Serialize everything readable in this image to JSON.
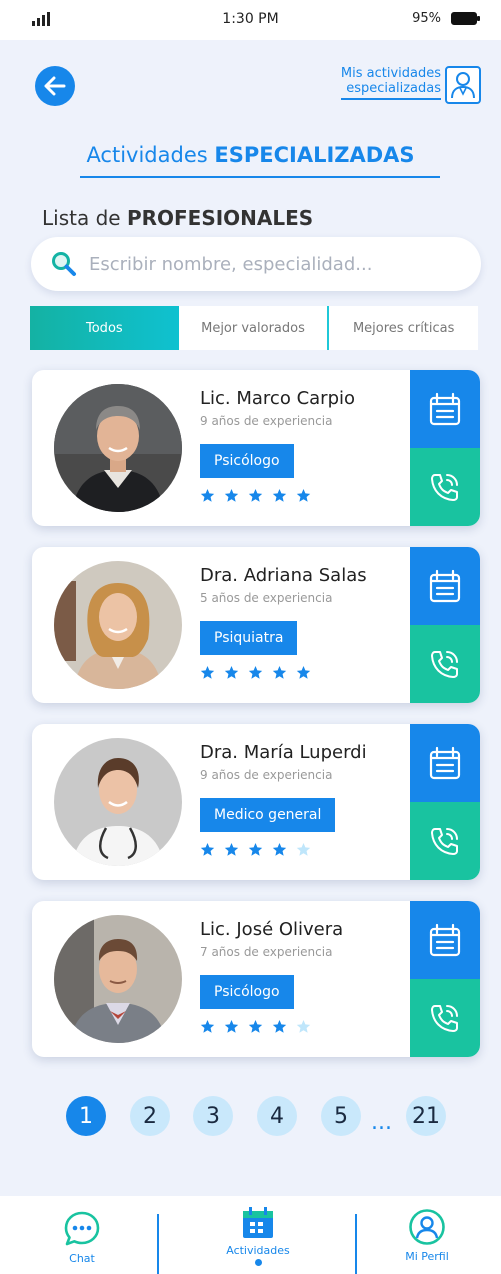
{
  "status_bar": {
    "time": "1:30 PM",
    "battery": "95%"
  },
  "header": {
    "my_activities_line1": "Mis actividades",
    "my_activities_line2": "especializadas",
    "title_normal": "Actividades ",
    "title_bold": "ESPECIALIZADAS"
  },
  "list": {
    "title_normal": "Lista de ",
    "title_bold": "PROFESIONALES"
  },
  "search": {
    "placeholder": "Escribir nombre, especialidad..."
  },
  "tabs": [
    {
      "label": "Todos",
      "active": true
    },
    {
      "label": "Mejor valorados",
      "active": false
    },
    {
      "label": "Mejores críticas",
      "active": false
    }
  ],
  "professionals": [
    {
      "name": "Lic. Marco Carpio",
      "experience": "9 años de experiencia",
      "specialty": "Psicólogo",
      "rating": 5
    },
    {
      "name": "Dra. Adriana Salas",
      "experience": "5 años de experiencia",
      "specialty": "Psiquiatra",
      "rating": 5
    },
    {
      "name": "Dra. María Luperdi",
      "experience": "9 años de experiencia",
      "specialty": "Medico general",
      "rating": 4
    },
    {
      "name": "Lic. José Olivera",
      "experience": "7 años de experiencia",
      "specialty": "Psicólogo",
      "rating": 4
    }
  ],
  "pagination": {
    "pages": [
      "1",
      "2",
      "3",
      "4",
      "5"
    ],
    "ellipsis": "...",
    "last": "21",
    "current": "1"
  },
  "bottom_nav": {
    "chat": "Chat",
    "activities": "Actividades",
    "profile": "Mi Perfil"
  },
  "colors": {
    "primary": "#1787ea",
    "teal": "#19c3a0",
    "star_on": "#1787ea",
    "star_off": "#bfe6fb",
    "background": "#eef2fb"
  }
}
